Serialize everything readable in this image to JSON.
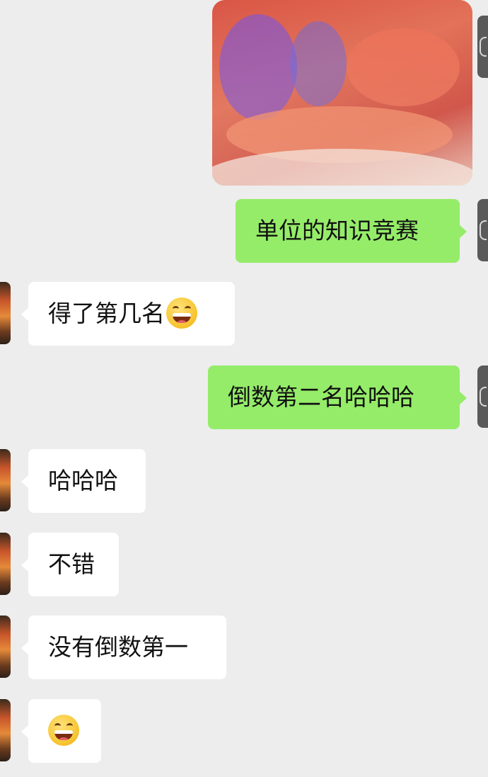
{
  "chat": {
    "messages": [
      {
        "sender": "me",
        "type": "image",
        "description_shown": "blurred-photo"
      },
      {
        "sender": "me",
        "type": "text",
        "text": "单位的知识竞赛"
      },
      {
        "sender": "other",
        "type": "text",
        "text": "得了第几名",
        "emoji": "grinning-squinting-face-icon"
      },
      {
        "sender": "me",
        "type": "text",
        "text": "倒数第二名哈哈哈"
      },
      {
        "sender": "other",
        "type": "text",
        "text": "哈哈哈"
      },
      {
        "sender": "other",
        "type": "text",
        "text": "不错"
      },
      {
        "sender": "other",
        "type": "text",
        "text": "没有倒数第一"
      },
      {
        "sender": "other",
        "type": "emoji",
        "emoji": "grinning-squinting-face-icon"
      }
    ]
  },
  "colors": {
    "background": "#ededed",
    "sent_bubble": "#95ec69",
    "received_bubble": "#ffffff"
  }
}
